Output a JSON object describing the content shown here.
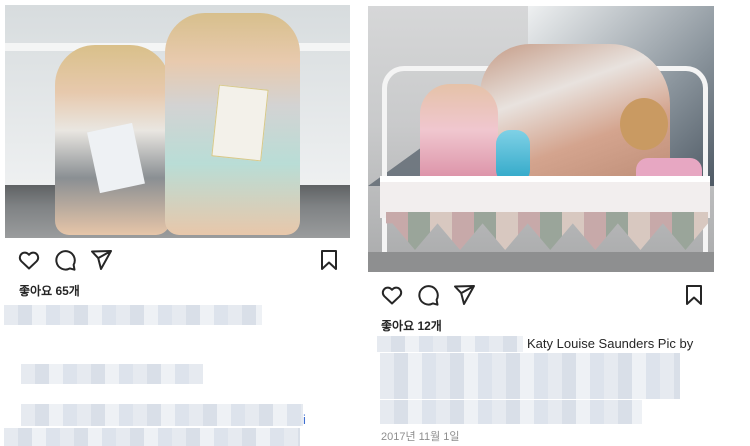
{
  "left_post": {
    "likes_label": "좋아요 65개",
    "trailing_char": "i",
    "icons": [
      "heart-icon",
      "comment-icon",
      "share-icon",
      "bookmark-icon"
    ]
  },
  "right_post": {
    "likes_label": "좋아요 12개",
    "caption_credit": "Katy Louise Saunders Pic by",
    "date": "2017년 11월 1일",
    "icons": [
      "heart-icon",
      "comment-icon",
      "share-icon",
      "bookmark-icon"
    ]
  },
  "colors": {
    "text": "#262626",
    "muted": "#8e8e8e",
    "link": "#3f6fd1",
    "blur": "#dde3ec"
  }
}
